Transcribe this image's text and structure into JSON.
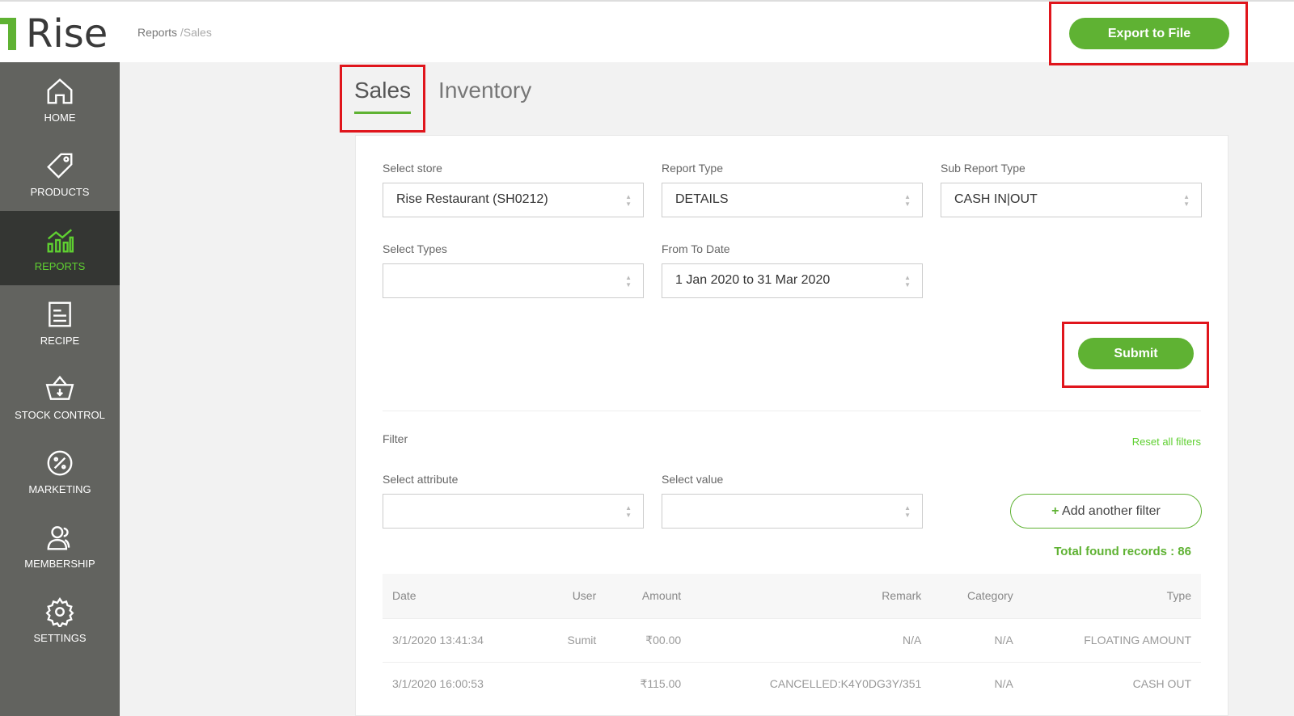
{
  "header": {
    "logo": "Rise",
    "breadcrumb": [
      "Reports",
      "/Sales"
    ],
    "export_label": "Export to File"
  },
  "sidebar": {
    "items": [
      {
        "label": "HOME",
        "icon": "home-icon"
      },
      {
        "label": "PRODUCTS",
        "icon": "tag-icon"
      },
      {
        "label": "REPORTS",
        "icon": "chart-icon",
        "active": true
      },
      {
        "label": "RECIPE",
        "icon": "recipe-icon"
      },
      {
        "label": "STOCK CONTROL",
        "icon": "basket-icon"
      },
      {
        "label": "MARKETING",
        "icon": "percent-badge-icon"
      },
      {
        "label": "MEMBERSHIP",
        "icon": "users-icon"
      },
      {
        "label": "SETTINGS",
        "icon": "gear-icon"
      }
    ]
  },
  "tabs": [
    {
      "label": "Sales",
      "active": true
    },
    {
      "label": "Inventory"
    }
  ],
  "form": {
    "store": {
      "label": "Select store",
      "value": "Rise Restaurant (SH0212)"
    },
    "report_type": {
      "label": "Report Type",
      "value": "DETAILS"
    },
    "sub_report_type": {
      "label": "Sub Report Type",
      "value": "CASH IN|OUT"
    },
    "types": {
      "label": "Select Types",
      "value": ""
    },
    "date": {
      "label": "From To Date",
      "value": "1 Jan 2020 to 31 Mar 2020"
    },
    "submit_label": "Submit"
  },
  "filter": {
    "title": "Filter",
    "reset_label": "Reset all filters",
    "attribute_label": "Select attribute",
    "value_label": "Select value",
    "add_label": "Add another filter",
    "total": "Total found records : 86"
  },
  "table": {
    "columns": [
      "Date",
      "User",
      "Amount",
      "Remark",
      "Category",
      "Type"
    ],
    "rows": [
      [
        "3/1/2020 13:41:34",
        "Sumit",
        "₹00.00",
        "N/A",
        "N/A",
        "FLOATING AMOUNT"
      ],
      [
        "3/1/2020 16:00:53",
        "",
        "₹115.00",
        "CANCELLED:K4Y0DG3Y/351",
        "N/A",
        "CASH OUT"
      ]
    ]
  },
  "colors": {
    "accent": "#5fb233",
    "highlight": "#e0151c",
    "sidebar": "#62635f"
  }
}
